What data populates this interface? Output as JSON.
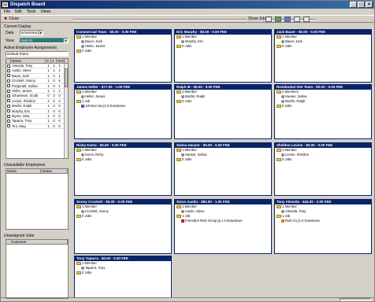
{
  "window": {
    "title": "Dispatch Board"
  },
  "menu": [
    "File",
    "Edit",
    "Tools",
    "Views"
  ],
  "toolbar": {
    "close_label": "Close",
    "show_label": "Show Jobs"
  },
  "left": {
    "current_display_title": "Current Display",
    "date_label": "Date",
    "date_value": "8/15/2006",
    "view_label": "View",
    "view_value": "Sort #1",
    "assign_title": "Active Employee Assignments",
    "assign_value": "Default Roles",
    "grid_headers": [
      "Name",
      "C",
      "J",
      "Ord"
    ],
    "employees": [
      {
        "name": "Almeida, Tony",
        "c": "1",
        "j": "1",
        "o": "4"
      },
      {
        "name": "Austin, Steve",
        "c": "1",
        "j": "1",
        "o": "4"
      },
      {
        "name": "Bauer, Jack",
        "c": "1",
        "j": "0",
        "o": "1"
      },
      {
        "name": "Crockett, Sonny",
        "c": "1",
        "j": "0",
        "o": "5"
      },
      {
        "name": "Fitzgerald, Salma",
        "c": "1",
        "j": "0",
        "o": "1"
      },
      {
        "name": "Heller, James",
        "c": "1",
        "j": "1",
        "o": "1"
      },
      {
        "name": "Johanssen, Scotti",
        "c": "0",
        "j": "0",
        "o": "0"
      },
      {
        "name": "Levine, Sheldon",
        "c": "1",
        "j": "0",
        "o": "0"
      },
      {
        "name": "Mazlin, Ralph",
        "c": "1",
        "j": "0",
        "o": "0"
      },
      {
        "name": "Murphy, Eric",
        "c": "1",
        "j": "0",
        "o": "0"
      },
      {
        "name": "Myers, Nina",
        "c": "1",
        "j": "0",
        "o": "0"
      },
      {
        "name": "Taparra, Tony",
        "c": "1",
        "j": "0",
        "o": "0"
      },
      {
        "name": "Tiro, Meg",
        "c": "1",
        "j": "0",
        "o": "0"
      }
    ],
    "unavailable_title": "Unavailable Employees",
    "unavailable_headers": [
      "Name",
      "Status"
    ],
    "unassigned_title": "Unassigned Jobs",
    "unassigned_headers": [
      "Customer"
    ]
  },
  "cards": [
    {
      "title": "Commercial Team - $0.00 - 0.00 FEE",
      "lines": [
        {
          "t": "1 Member",
          "k": "folder",
          "l": 0
        },
        {
          "t": "Bauer, Jack",
          "k": "person",
          "l": 1
        },
        {
          "t": "Heller, James",
          "k": "person",
          "l": 1
        },
        {
          "t": "0 Jobs",
          "k": "folder",
          "l": 0
        }
      ]
    },
    {
      "title": "Eric Murphy - $0.00 - 0.00 FEE",
      "lines": [
        {
          "t": "1 Member",
          "k": "folder",
          "l": 0
        },
        {
          "t": "Murphy, Eric",
          "k": "person",
          "l": 1
        },
        {
          "t": "0 Jobs",
          "k": "folder",
          "l": 0
        }
      ]
    },
    {
      "title": "Jack Bauer - $0.00 - 0.00 FEE",
      "lines": [
        {
          "t": "1 Member",
          "k": "folder",
          "l": 0
        },
        {
          "t": "Bauer, Jack",
          "k": "person",
          "l": 1
        },
        {
          "t": "0 Jobs",
          "k": "folder",
          "l": 0
        }
      ]
    },
    {
      "title": "James Heller - $77.00 - 1.00 FEE",
      "lines": [
        {
          "t": "1 Member",
          "k": "folder",
          "l": 0
        },
        {
          "t": "Heller, James",
          "k": "person",
          "l": 1
        },
        {
          "t": "1 Job",
          "k": "folder",
          "l": 0
        },
        {
          "t": "Johnson Bu [1.0 Downtown",
          "k": "job",
          "l": 1
        }
      ]
    },
    {
      "title": "Ralph M - $0.00 - 0.00 FEE",
      "lines": [
        {
          "t": "1 Member",
          "k": "folder",
          "l": 0
        },
        {
          "t": "Mazlin, Ralph",
          "k": "person",
          "l": 1
        },
        {
          "t": "0 Jobs",
          "k": "folder",
          "l": 0
        }
      ]
    },
    {
      "title": "Residential Site Team - $0.00 - 0.00 FEE",
      "lines": [
        {
          "t": "2 Members",
          "k": "folder",
          "l": 0
        },
        {
          "t": "Hauser, Salma",
          "k": "person",
          "l": 1
        },
        {
          "t": "Mazlin, Ralph",
          "k": "person",
          "l": 1
        },
        {
          "t": "0 Jobs",
          "k": "folder",
          "l": 0
        }
      ]
    },
    {
      "title": "Ricky Kemo - $0.00 - 0.00 FEE",
      "lines": [
        {
          "t": "1 Member",
          "k": "folder",
          "l": 0
        },
        {
          "t": "Kemo, Ricky",
          "k": "person",
          "l": 1
        },
        {
          "t": "0 Jobs",
          "k": "folder",
          "l": 0
        }
      ]
    },
    {
      "title": "Salma Hauser - $0.00 - 0.00 FEE",
      "lines": [
        {
          "t": "1 Member",
          "k": "folder",
          "l": 0
        },
        {
          "t": "Hauser, Salma",
          "k": "person",
          "l": 1
        },
        {
          "t": "0 Jobs",
          "k": "folder",
          "l": 0
        }
      ]
    },
    {
      "title": "Sheldon Levine - $0.00 - 0.00 FEE",
      "lines": [
        {
          "t": "1 Member",
          "k": "folder",
          "l": 0
        },
        {
          "t": "Levine, Sheldon",
          "k": "person",
          "l": 1
        },
        {
          "t": "0 Jobs",
          "k": "folder",
          "l": 0
        }
      ]
    },
    {
      "title": "Sonny Crockett - $0.00 - 0.00 FEE",
      "lines": [
        {
          "t": "1 Member",
          "k": "folder",
          "l": 0
        },
        {
          "t": "Crockett, Sonny",
          "k": "person",
          "l": 1
        },
        {
          "t": "0 Jobs",
          "k": "folder",
          "l": 0
        }
      ]
    },
    {
      "title": "Steve Austin - $82.50 - 1.00 FEE",
      "lines": [
        {
          "t": "1 Member",
          "k": "folder",
          "l": 0
        },
        {
          "t": "Austin, Steve",
          "k": "person",
          "l": 1
        },
        {
          "t": "1 Job",
          "k": "folder",
          "l": 0
        },
        {
          "t": "Friendly's Rest Group [p 1.0 Downtown",
          "k": "job-red",
          "l": 1
        }
      ]
    },
    {
      "title": "Tony Almeida - $44.00 - 2.00 FEE",
      "lines": [
        {
          "t": "1 Member",
          "k": "folder",
          "l": 0
        },
        {
          "t": "Almeida, Tony",
          "k": "person",
          "l": 1
        },
        {
          "t": "1 Job",
          "k": "folder",
          "l": 0
        },
        {
          "t": "Ruth Ku [1.0 Downtown",
          "k": "job-orange",
          "l": 1
        }
      ]
    },
    {
      "title": "Tony Taparra - $0.00 - 0.00 FEE",
      "lines": [
        {
          "t": "1 Member",
          "k": "folder",
          "l": 0
        },
        {
          "t": "Taparra, Tony",
          "k": "person",
          "l": 1
        },
        {
          "t": "0 Jobs",
          "k": "folder",
          "l": 0
        }
      ]
    }
  ]
}
